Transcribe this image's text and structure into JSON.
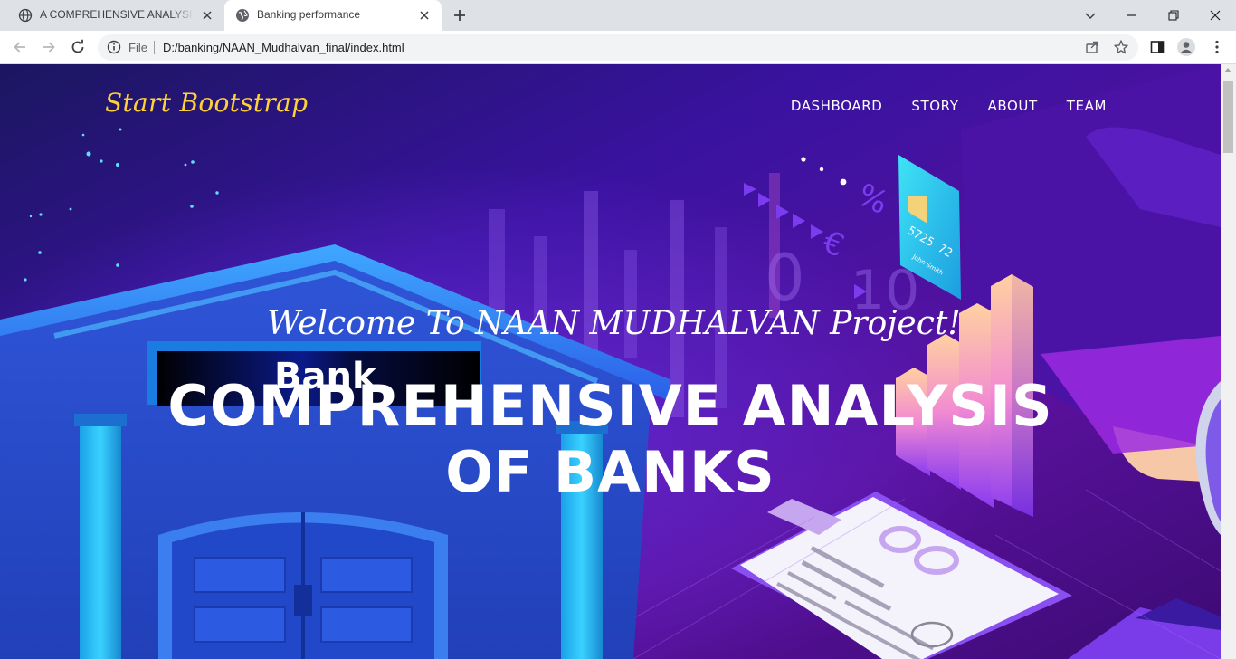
{
  "browser": {
    "tabs": [
      {
        "title": "A COMPREHENSIVE ANALYSIS OF BANKS",
        "active": false,
        "icon": "globe-icon"
      },
      {
        "title": "Banking performance",
        "active": true,
        "icon": "globe-icon"
      }
    ],
    "omnibox": {
      "scheme_label": "File",
      "url": "D:/banking/NAAN_Mudhalvan_final/index.html"
    }
  },
  "page": {
    "brand": "Start Bootstrap",
    "nav": [
      "DASHBOARD",
      "STORY",
      "ABOUT",
      "TEAM"
    ],
    "subheading": "Welcome To NAAN MUDHALVAN Project!",
    "heading_line1": "COMPREHENSIVE ANALYSIS",
    "heading_line2": "OF BANKS",
    "art": {
      "bank_sign": "Bank",
      "card_number": "5725 72",
      "card_name": "John Smith",
      "percent_symbol": "%",
      "euro_symbol": "€",
      "chart_digits": "0",
      "chart_digits_2": "10"
    }
  },
  "colors": {
    "brand": "#fed136",
    "hero_base": "#2a0d6b",
    "tabbar": "#dee1e6"
  }
}
